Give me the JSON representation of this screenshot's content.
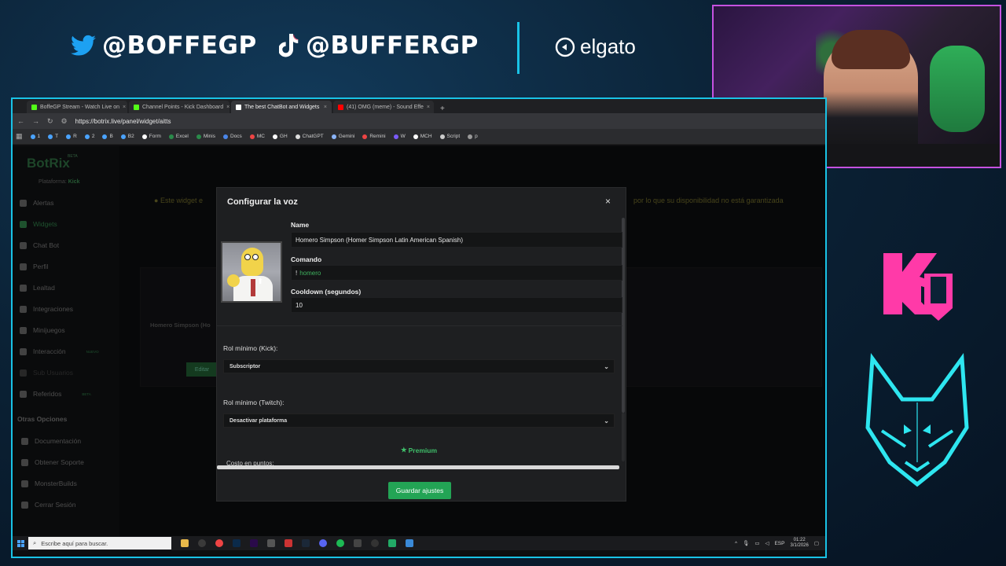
{
  "overlay": {
    "twitter_handle": "@BOFFEGP",
    "tiktok_handle": "@BUFFERGP",
    "sponsor": "elgato",
    "accent_color": "#19c3e6"
  },
  "browser": {
    "tabs": [
      {
        "label": "BoffeGP Stream - Watch Live on",
        "favicon_color": "#53fc18"
      },
      {
        "label": "Channel Points - Kick Dashboard",
        "favicon_color": "#53fc18"
      },
      {
        "label": "The best ChatBot and Widgets",
        "favicon_color": "#ffffff"
      },
      {
        "label": "(41) OMG (meme) - Sound Effe",
        "favicon_color": "#ff0000"
      }
    ],
    "url": "https://botrix.live/panel/widget/aitts",
    "bookmarks": [
      "1",
      "T",
      "R",
      "2",
      "B",
      "B2",
      "Form",
      "Excel",
      "Minis",
      "Docs",
      "MC",
      "GH",
      "ChatGPT",
      "Gemini",
      "Remini",
      "W",
      "MCH",
      "Script",
      "p"
    ]
  },
  "sidebar": {
    "logo": "BotRix",
    "beta": "BETA",
    "platform_label": "Plataforma:",
    "platform_value": "Kick",
    "items": [
      {
        "label": "Alertas"
      },
      {
        "label": "Widgets"
      },
      {
        "label": "Chat Bot"
      },
      {
        "label": "Perfil"
      },
      {
        "label": "Lealtad"
      },
      {
        "label": "Integraciones"
      },
      {
        "label": "Minijuegos"
      },
      {
        "label": "Interacción",
        "badge": "NUEVO"
      },
      {
        "label": "Sub Usuarios"
      },
      {
        "label": "Referidos",
        "badge": "BETA"
      }
    ],
    "section_title": "Otras Opciones",
    "other_items": [
      {
        "label": "Documentación"
      },
      {
        "label": "Obtener Soporte"
      },
      {
        "label": "MonsterBuilds"
      },
      {
        "label": "Cerrar Sesión"
      }
    ]
  },
  "background": {
    "notice_start": "Este widget e",
    "notice_end": "por lo que su disponibilidad no está garantizada",
    "card_name": "Homero Simpson (Ho",
    "card_button": "Editar"
  },
  "modal": {
    "title": "Configurar la voz",
    "close": "×",
    "name_label": "Name",
    "name_value": "Homero Simpson (Homer Simpson Latin American Spanish)",
    "command_label": "Comando",
    "command_prefix": "!",
    "command_value": "homero",
    "cooldown_label": "Cooldown (segundos)",
    "cooldown_value": "10",
    "role_kick_label": "Rol mínimo (Kick):",
    "role_kick_value": "Subscriptor",
    "role_twitch_label": "Rol mínimo (Twitch):",
    "role_twitch_value": "Desactivar plataforma",
    "premium_label": "Premium",
    "cost_label": "Costo en puntos:",
    "save_button": "Guardar ajustes"
  },
  "taskbar": {
    "search_placeholder": "Escribe aquí para buscar.",
    "lang": "ESP",
    "time": "01:22",
    "date": "3/1/2026"
  }
}
